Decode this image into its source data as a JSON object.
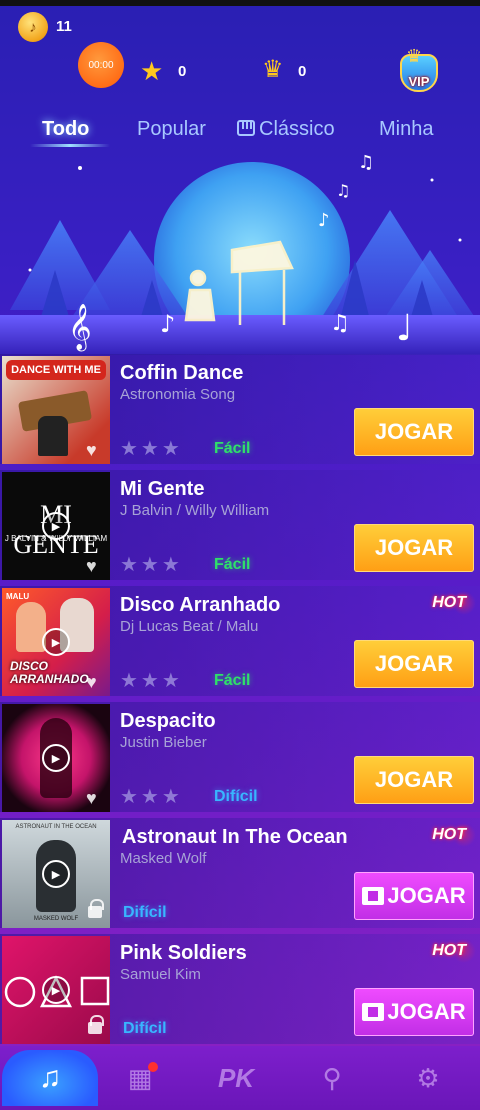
{
  "stats": {
    "coins": "11",
    "timer": "00:00",
    "stars": "0",
    "crowns": "0",
    "vip_label": "VIP"
  },
  "tabs": [
    {
      "label": "Todo",
      "active": true
    },
    {
      "label": "Popular",
      "active": false
    },
    {
      "label": "Clássico",
      "active": false
    },
    {
      "label": "Minha",
      "active": false
    }
  ],
  "songs": [
    {
      "title": "Coffin Dance",
      "artist": "Astronomia Song",
      "difficulty": "Fácil",
      "hot": false,
      "button": "JOGAR",
      "button_style": "orange",
      "stars_shown": true,
      "locked": false,
      "cover_text": "DANCE WITH ME"
    },
    {
      "title": "Mi Gente",
      "artist": "J Balvin / Willy William",
      "difficulty": "Fácil",
      "hot": false,
      "button": "JOGAR",
      "button_style": "orange",
      "stars_shown": true,
      "locked": false,
      "cover_text": "MI GENTE",
      "cover_sub": "J BALVIN & WILLY WILLIAM"
    },
    {
      "title": "Disco Arranhado",
      "artist": "Dj Lucas Beat / Malu",
      "difficulty": "Fácil",
      "hot": true,
      "hot_label": "HOT",
      "button": "JOGAR",
      "button_style": "orange",
      "stars_shown": true,
      "locked": false,
      "cover_text": "DISCO ARRANHADO",
      "cover_sub": "MALU"
    },
    {
      "title": "Despacito",
      "artist": "Justin Bieber",
      "difficulty": "Difícil",
      "hot": false,
      "button": "JOGAR",
      "button_style": "orange",
      "stars_shown": true,
      "locked": false
    },
    {
      "title": "Astronaut In The Ocean",
      "artist": "Masked Wolf",
      "difficulty": "Difícil",
      "hot": true,
      "hot_label": "HOT",
      "button": "JOGAR",
      "button_style": "purple",
      "stars_shown": false,
      "locked": true,
      "cover_text": "ASTRONAUT IN THE OCEAN",
      "cover_sub": "MASKED WOLF"
    },
    {
      "title": "Pink Soldiers",
      "artist": "Samuel Kim",
      "difficulty": "Difícil",
      "hot": true,
      "hot_label": "HOT",
      "button": "JOGAR",
      "button_style": "purple",
      "stars_shown": false,
      "locked": true
    }
  ],
  "bottom_nav": [
    {
      "icon": "music-note-icon",
      "active": true
    },
    {
      "icon": "shop-icon",
      "active": false,
      "badge": true
    },
    {
      "icon": "pk-icon",
      "active": false,
      "label": "PK"
    },
    {
      "icon": "search-icon",
      "active": false
    },
    {
      "icon": "gear-icon",
      "active": false
    }
  ],
  "colors": {
    "easy": "#2fe06a",
    "hard": "#38b6ff",
    "button_orange": "#ffb020",
    "button_purple": "#d83cf2",
    "hot": "#ff2a4a"
  }
}
